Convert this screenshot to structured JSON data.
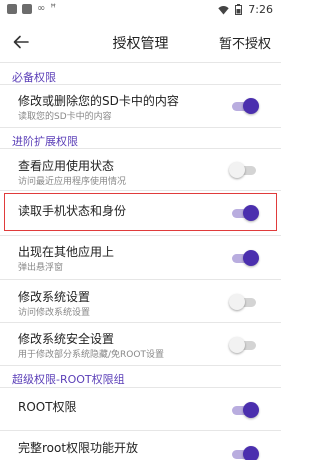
{
  "status_bar": {
    "left_glyphs": [
      "∞",
      "ꟸ"
    ],
    "time": "7:26"
  },
  "app_bar": {
    "title": "授权管理",
    "action": "暂不授权"
  },
  "sections": {
    "required": {
      "header": "必备权限"
    },
    "extended": {
      "header": "进阶扩展权限"
    },
    "root": {
      "header": "超级权限-ROOT权限组"
    }
  },
  "permissions": [
    {
      "title": "修改或删除您的SD卡中的内容",
      "subtitle": "读取您的SD卡中的内容",
      "enabled": true
    },
    {
      "title": "查看应用使用状态",
      "subtitle": "访问最近应用程序使用情况",
      "enabled": false
    },
    {
      "title": "读取手机状态和身份",
      "subtitle": "",
      "enabled": true
    },
    {
      "title": "出现在其他应用上",
      "subtitle": "弹出悬浮窗",
      "enabled": true
    },
    {
      "title": "修改系统设置",
      "subtitle": "访问修改系统设置",
      "enabled": false
    },
    {
      "title": "修改系统安全设置",
      "subtitle": "用于修改部分系统隐藏/免ROOT设置",
      "enabled": false
    },
    {
      "title": "ROOT权限",
      "subtitle": "",
      "enabled": true
    },
    {
      "title": "完整root权限功能开放",
      "subtitle": "",
      "enabled": true
    }
  ],
  "colors": {
    "accent": "#4b2fae",
    "section_header": "#5b3fb8",
    "highlight": "#e03b3b"
  }
}
